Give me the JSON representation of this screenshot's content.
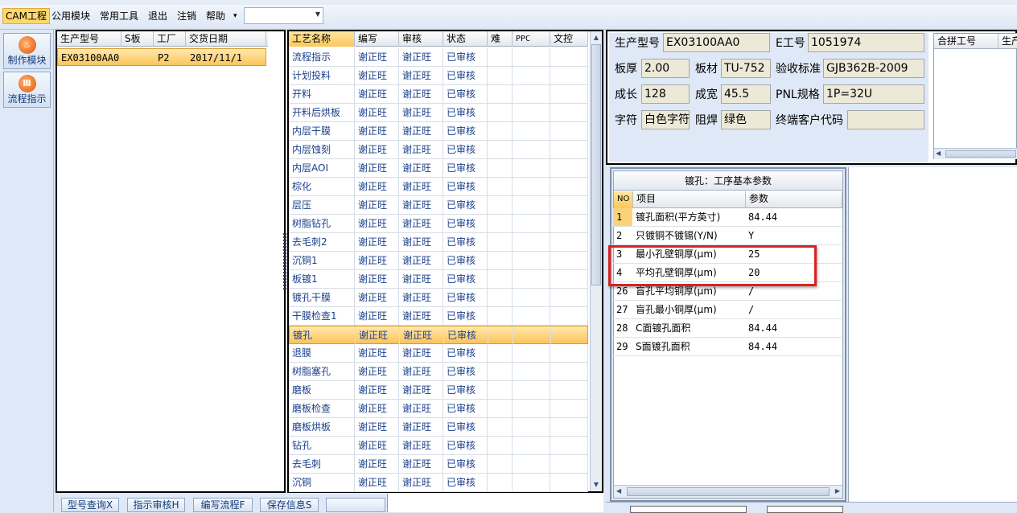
{
  "menu": {
    "items": [
      "CAM工程",
      "公用模块",
      "常用工具",
      "退出",
      "注销",
      "帮助"
    ],
    "help_arrow": "▾",
    "combo_value": ""
  },
  "nav": [
    {
      "label": "制作模块",
      "icon": "fire-icon"
    },
    {
      "label": "流程指示",
      "icon": "flow-icon"
    }
  ],
  "order_grid": {
    "columns": [
      "生产型号",
      "S板",
      "工厂",
      "交货日期"
    ],
    "rows": [
      {
        "model": "EX03100AA0",
        "s_board": "",
        "factory": "P2",
        "date": "2017/11/1"
      }
    ]
  },
  "process_grid": {
    "columns": [
      "工艺名称",
      "编写",
      "审核",
      "状态",
      "难",
      "PPC",
      "文控"
    ],
    "rows": [
      {
        "name": "流程指示",
        "writer": "谢正旺",
        "reviewer": "谢正旺",
        "status": "已审核"
      },
      {
        "name": "计划投料",
        "writer": "谢正旺",
        "reviewer": "谢正旺",
        "status": "已审核"
      },
      {
        "name": "开料",
        "writer": "谢正旺",
        "reviewer": "谢正旺",
        "status": "已审核"
      },
      {
        "name": "开料后烘板",
        "writer": "谢正旺",
        "reviewer": "谢正旺",
        "status": "已审核"
      },
      {
        "name": "内层干膜",
        "writer": "谢正旺",
        "reviewer": "谢正旺",
        "status": "已审核"
      },
      {
        "name": "内层蚀刻",
        "writer": "谢正旺",
        "reviewer": "谢正旺",
        "status": "已审核"
      },
      {
        "name": "内层AOI",
        "writer": "谢正旺",
        "reviewer": "谢正旺",
        "status": "已审核"
      },
      {
        "name": "棕化",
        "writer": "谢正旺",
        "reviewer": "谢正旺",
        "status": "已审核"
      },
      {
        "name": "层压",
        "writer": "谢正旺",
        "reviewer": "谢正旺",
        "status": "已审核"
      },
      {
        "name": "树脂钻孔",
        "writer": "谢正旺",
        "reviewer": "谢正旺",
        "status": "已审核"
      },
      {
        "name": "去毛刺2",
        "writer": "谢正旺",
        "reviewer": "谢正旺",
        "status": "已审核"
      },
      {
        "name": "沉铜1",
        "writer": "谢正旺",
        "reviewer": "谢正旺",
        "status": "已审核"
      },
      {
        "name": "板镀1",
        "writer": "谢正旺",
        "reviewer": "谢正旺",
        "status": "已审核"
      },
      {
        "name": "镀孔干膜",
        "writer": "谢正旺",
        "reviewer": "谢正旺",
        "status": "已审核"
      },
      {
        "name": "干膜检查1",
        "writer": "谢正旺",
        "reviewer": "谢正旺",
        "status": "已审核"
      },
      {
        "name": "镀孔",
        "writer": "谢正旺",
        "reviewer": "谢正旺",
        "status": "已审核"
      },
      {
        "name": "退膜",
        "writer": "谢正旺",
        "reviewer": "谢正旺",
        "status": "已审核"
      },
      {
        "name": "树脂塞孔",
        "writer": "谢正旺",
        "reviewer": "谢正旺",
        "status": "已审核"
      },
      {
        "name": "磨板",
        "writer": "谢正旺",
        "reviewer": "谢正旺",
        "status": "已审核"
      },
      {
        "name": "磨板检查",
        "writer": "谢正旺",
        "reviewer": "谢正旺",
        "status": "已审核"
      },
      {
        "name": "磨板烘板",
        "writer": "谢正旺",
        "reviewer": "谢正旺",
        "status": "已审核"
      },
      {
        "name": "钻孔",
        "writer": "谢正旺",
        "reviewer": "谢正旺",
        "status": "已审核"
      },
      {
        "name": "去毛刺",
        "writer": "谢正旺",
        "reviewer": "谢正旺",
        "status": "已审核"
      },
      {
        "name": "沉铜",
        "writer": "谢正旺",
        "reviewer": "谢正旺",
        "status": "已审核"
      }
    ]
  },
  "info": {
    "model_label": "生产型号",
    "model": "EX03100AA0",
    "eno_label": "E工号",
    "eno": "1051974",
    "thickness_label": "板厚",
    "thickness": "2.00",
    "material_label": "板材",
    "material": "TU-752",
    "standard_label": "验收标准",
    "standard": "GJB362B-2009",
    "length_label": "成长",
    "length": "128",
    "width_label": "成宽",
    "width": "45.5",
    "pnl_label": "PNL规格",
    "pnl": "1P=32U",
    "char_label": "字符",
    "char_color": "白色字符",
    "mask_label": "阻焊",
    "mask_color": "绿色",
    "customer_label": "终端客户代码",
    "customer": ""
  },
  "merge_grid": {
    "columns": [
      "合拼工号",
      "生产"
    ]
  },
  "params": {
    "title": "镀孔：工序基本参数",
    "columns": [
      "NO",
      "项目",
      "参数"
    ],
    "rows": [
      {
        "no": "1",
        "item": "镀孔面积(平方英寸)",
        "value": "84.44"
      },
      {
        "no": "2",
        "item": "只镀铜不镀锡(Y/N)",
        "value": "Y"
      },
      {
        "no": "3",
        "item": "最小孔壁铜厚(μm)",
        "value": "25"
      },
      {
        "no": "4",
        "item": "平均孔壁铜厚(μm)",
        "value": "20"
      },
      {
        "no": "26",
        "item": "盲孔平均铜厚(μm)",
        "value": "/"
      },
      {
        "no": "27",
        "item": "盲孔最小铜厚(μm)",
        "value": "/"
      },
      {
        "no": "28",
        "item": "C面镀孔面积",
        "value": "84.44"
      },
      {
        "no": "29",
        "item": "S面镀孔面积",
        "value": "84.44"
      }
    ]
  },
  "bottom_buttons": [
    "型号查询X",
    "指示审核H",
    "编写流程F",
    "保存信息S",
    ""
  ],
  "colors": {
    "highlight_box": "#d9221f",
    "selected_row": "#fbc45c"
  }
}
